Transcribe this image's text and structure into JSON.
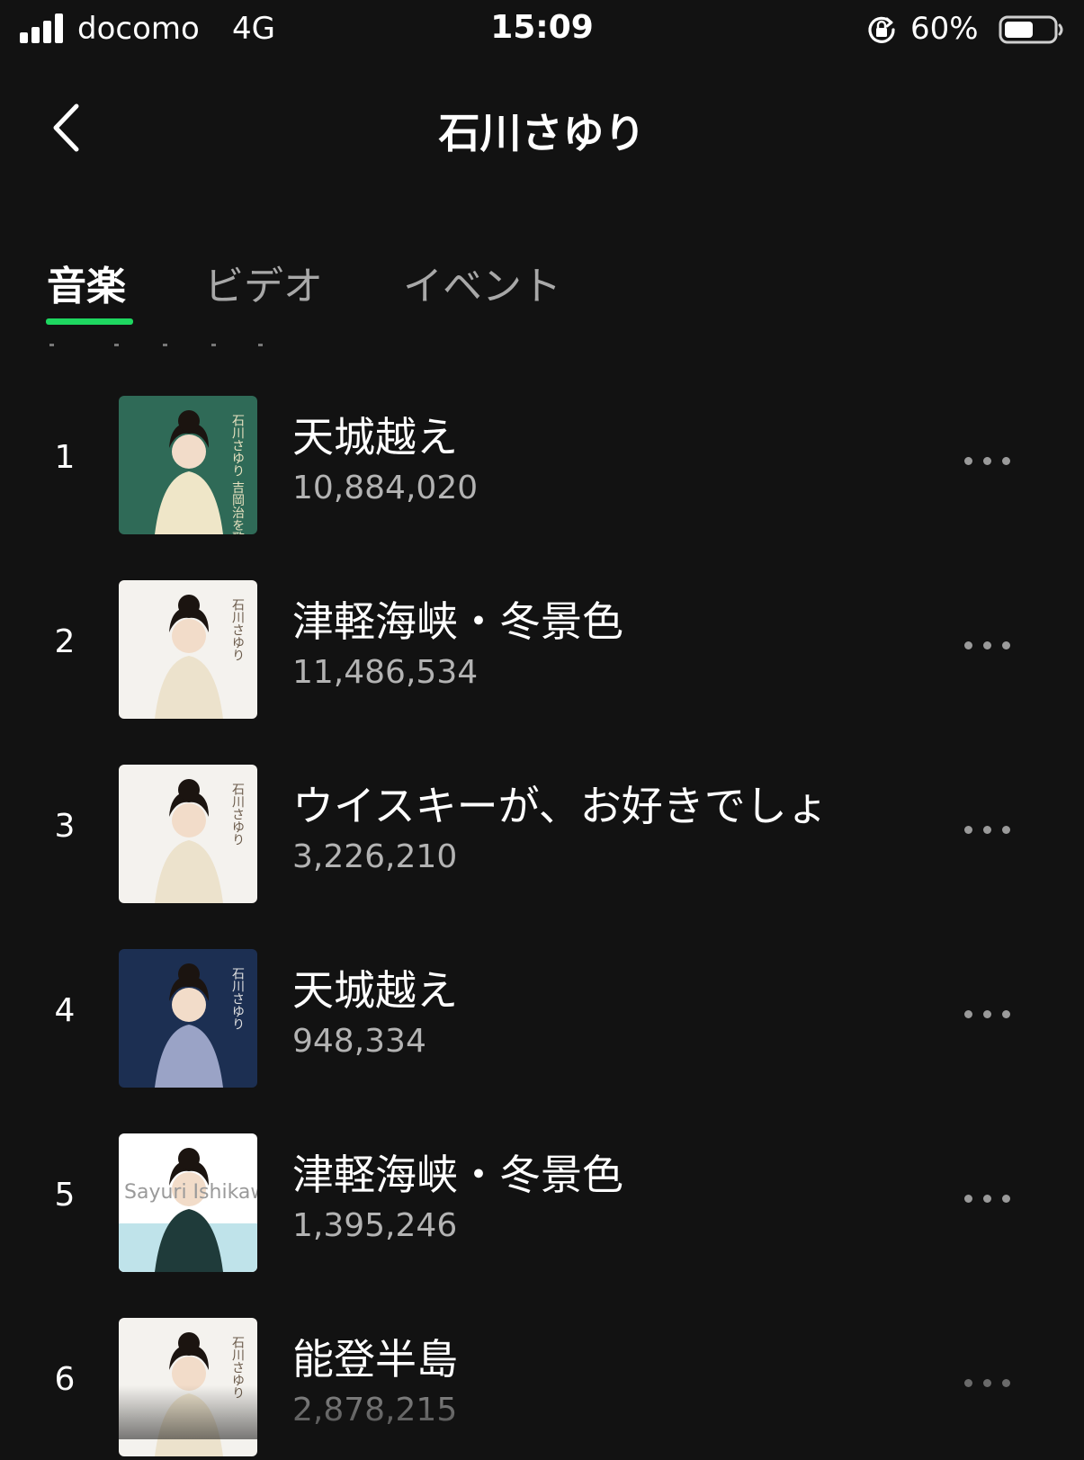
{
  "status_bar": {
    "carrier": "docomo",
    "network": "4G",
    "time": "15:09",
    "battery": "60%",
    "battery_level": 0.6
  },
  "header": {
    "title": "石川さゆり",
    "back_icon": "chevron-left-icon"
  },
  "tabs": [
    {
      "label": "音楽",
      "active": true
    },
    {
      "label": "ビデオ",
      "active": false
    },
    {
      "label": "イベント",
      "active": false
    }
  ],
  "accent_color": "#1ed760",
  "tracks": [
    {
      "rank": "1",
      "title": "天城越え",
      "plays": "10,884,020"
    },
    {
      "rank": "2",
      "title": "津軽海峡・冬景色",
      "plays": "11,486,534"
    },
    {
      "rank": "3",
      "title": "ウイスキーが、お好きでしょ",
      "plays": "3,226,210"
    },
    {
      "rank": "4",
      "title": "天城越え",
      "plays": "948,334"
    },
    {
      "rank": "5",
      "title": "津軽海峡・冬景色",
      "plays": "1,395,246"
    },
    {
      "rank": "6",
      "title": "能登半島",
      "plays": "2,878,215"
    }
  ],
  "covers": [
    {
      "text": "石川さゆり 吉岡治を歌う"
    },
    {
      "text": "石川さゆり"
    },
    {
      "text": "石川さゆり"
    },
    {
      "text": "石川さゆり"
    },
    {
      "text": "Sayuri Ishikawa"
    },
    {
      "text": "石川さゆり"
    }
  ]
}
